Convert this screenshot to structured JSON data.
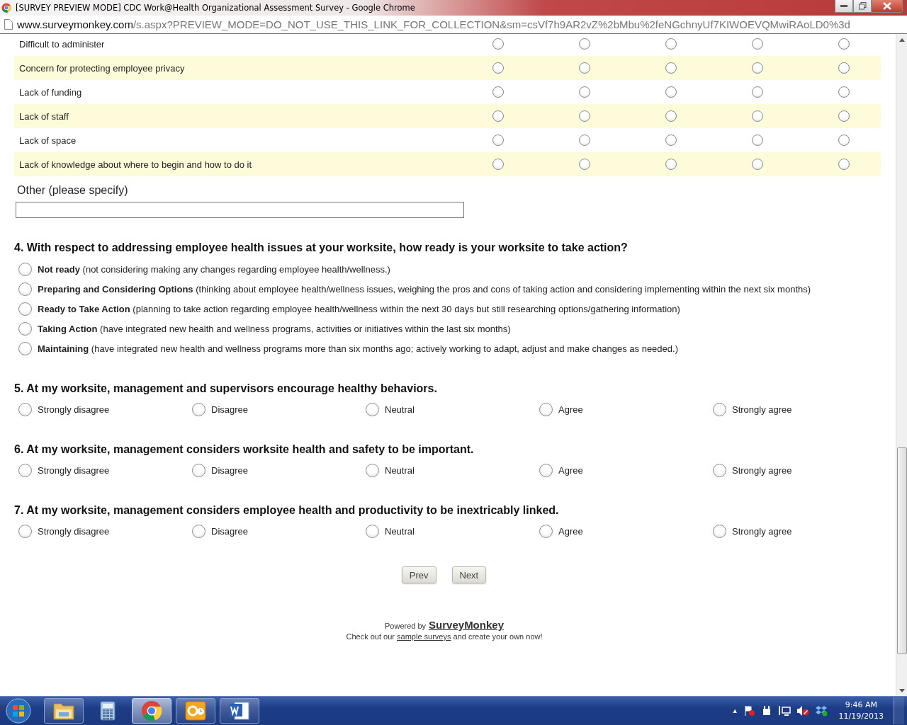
{
  "window": {
    "title": "[SURVEY PREVIEW MODE] CDC Work@Health Organizational Assessment Survey - Google Chrome",
    "url_domain": "www.surveymonkey.com",
    "url_path": "/s.aspx?PREVIEW_MODE=DO_NOT_USE_THIS_LINK_FOR_COLLECTION&sm=csVf7h9AR2vZ%2bMbu%2feNGchnyUf7KIWOEVQMwiRAoLD0%3d"
  },
  "matrix": {
    "rows": [
      {
        "label": "Difficult to administer",
        "radios": [
          {
            "selected": false
          },
          {
            "selected": false
          },
          {
            "selected": false
          },
          {
            "selected": false
          },
          {
            "selected": false
          }
        ]
      },
      {
        "label": "Concern for protecting employee privacy",
        "radios": [
          {
            "selected": false
          },
          {
            "selected": false
          },
          {
            "selected": false
          },
          {
            "selected": false
          },
          {
            "selected": false
          }
        ]
      },
      {
        "label": "Lack of funding",
        "radios": [
          {
            "selected": false
          },
          {
            "selected": false
          },
          {
            "selected": false
          },
          {
            "selected": false
          },
          {
            "selected": false
          }
        ]
      },
      {
        "label": "Lack of staff",
        "radios": [
          {
            "selected": false
          },
          {
            "selected": false
          },
          {
            "selected": false
          },
          {
            "selected": false
          },
          {
            "selected": false
          }
        ]
      },
      {
        "label": "Lack of space",
        "radios": [
          {
            "selected": false
          },
          {
            "selected": false
          },
          {
            "selected": false
          },
          {
            "selected": false
          },
          {
            "selected": false
          }
        ]
      },
      {
        "label": "Lack of knowledge about where to begin and how to do it",
        "radios": [
          {
            "selected": false
          },
          {
            "selected": false
          },
          {
            "selected": false
          },
          {
            "selected": false
          },
          {
            "selected": false
          }
        ]
      }
    ],
    "other_label": "Other (please specify)"
  },
  "questions": [
    {
      "kind": "list",
      "title": "4. With respect to addressing employee health issues at your worksite, how ready is your worksite to take action?",
      "options": [
        {
          "label": "**Not ready** (not considering making any changes regarding employee health/wellness.)",
          "selected": false
        },
        {
          "label": "**Preparing and Considering Options** (thinking about employee health/wellness issues, weighing the pros and cons of taking action and considering implementing within the next six months)",
          "selected": false
        },
        {
          "label": "**Ready to Take Action** (planning to take action regarding employee health/wellness within the next 30 days but still researching options/gathering information)",
          "selected": false
        },
        {
          "label": "**Taking Action** (have integrated new health and wellness programs, activities or initiatives within the last six months)",
          "selected": false
        },
        {
          "label": "**Maintaining** (have integrated new health and wellness programs more than six months ago; actively working to adapt, adjust and make changes as needed.)",
          "selected": false
        }
      ]
    },
    {
      "kind": "scale",
      "title": "5. At my worksite, management and supervisors encourage healthy behaviors.",
      "options": [
        {
          "label": "Strongly disagree",
          "selected": false
        },
        {
          "label": "Disagree",
          "selected": false
        },
        {
          "label": "Neutral",
          "selected": false
        },
        {
          "label": "Agree",
          "selected": false
        },
        {
          "label": "Strongly agree",
          "selected": false
        }
      ]
    },
    {
      "kind": "scale",
      "title": "6. At my worksite, management considers worksite health and safety to be important.",
      "options": [
        {
          "label": "Strongly disagree",
          "selected": false
        },
        {
          "label": "Disagree",
          "selected": false
        },
        {
          "label": "Neutral",
          "selected": false
        },
        {
          "label": "Agree",
          "selected": false
        },
        {
          "label": "Strongly agree",
          "selected": false
        }
      ]
    },
    {
      "kind": "scale",
      "title": "7. At my worksite, management considers employee health and productivity to be inextricably linked.",
      "options": [
        {
          "label": "Strongly disagree",
          "selected": false
        },
        {
          "label": "Disagree",
          "selected": false
        },
        {
          "label": "Neutral",
          "selected": false
        },
        {
          "label": "Agree",
          "selected": false
        },
        {
          "label": "Strongly agree",
          "selected": false
        }
      ]
    }
  ],
  "buttons": [
    "Prev",
    "Next"
  ],
  "footer": {
    "powered_by": "Powered by",
    "brand": "SurveyMonkey",
    "line2_before": "Check out our",
    "line2_link": "sample surveys",
    "line2_after": "and create your own now!"
  },
  "taskbar": {
    "apps": [
      {
        "kind": "folder",
        "selected": false
      },
      {
        "kind": "calculator",
        "selected": false
      },
      {
        "kind": "browser",
        "selected": true
      },
      {
        "kind": "mail",
        "selected": false
      },
      {
        "kind": "document",
        "selected": false
      }
    ],
    "tray_arrow": "▲",
    "time": "9:46 AM",
    "date": "11/19/2013"
  }
}
